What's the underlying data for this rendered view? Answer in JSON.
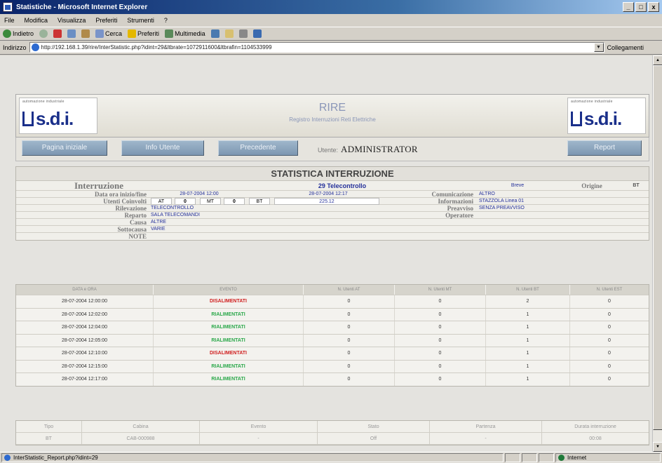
{
  "window": {
    "title": "Statistiche - Microsoft Internet Explorer",
    "min": "_",
    "max": "□",
    "close": "x"
  },
  "menu": [
    "File",
    "Modifica",
    "Visualizza",
    "Preferiti",
    "Strumenti",
    "?"
  ],
  "toolbar": {
    "back": "Indietro",
    "search": "Cerca",
    "favorites": "Preferiti",
    "media": "Multimedia"
  },
  "address": {
    "label": "Indirizzo",
    "url": "http://192.168.1.39/rire/InterStatistic.php?idint=29&ltbrate=1072911600&ltbrafin=1104533999",
    "go": "Collegamenti"
  },
  "header": {
    "logo_small": "automazione industriale",
    "logo_text": "s.d.i.",
    "title": "RIRE",
    "subtitle": "Registro Interruzioni Reti Elettriche"
  },
  "nav": {
    "home": "Pagina iniziale",
    "info": "Info Utente",
    "prev": "Precedente",
    "user_label": "Utente:",
    "user": "ADMINISTRATOR",
    "report": "Report"
  },
  "stat": {
    "title": "STATISTICA INTERRUZIONE",
    "interruzione_label": "Interruzione",
    "interruzione_value": "29 Telecontrollo",
    "breve": "Breve",
    "origine_label": "Origine",
    "origine_value": "BT",
    "data_label": "Data ora inizio/fine",
    "data_inizio": "28-07-2004 12:00",
    "data_fine": "28-07-2004 12:17",
    "comunicazione_label": "Comunicazione",
    "comunicazione_value": "ALTRO",
    "utenti_label": "Utenti Coinvolti",
    "u_at": "AT",
    "u_at_v": "0",
    "u_mt": "MT",
    "u_mt_v": "0",
    "u_bt": "BT",
    "u_bt_v": "225.12",
    "informazioni_label": "Informazioni",
    "informazioni_value": "STAZZOLA Linea 01",
    "rilevazione_label": "Rilevazione",
    "rilevazione_value": "TELECONTROLLO",
    "preavviso_label": "Preavviso",
    "preavviso_value": "SENZA PREAVVISO",
    "reparto_label": "Reparto",
    "reparto_value": "SALA TELECOMANDI",
    "operatore_label": "Operatore",
    "causa_label": "Causa",
    "causa_value": "ALTRE",
    "sottocausa_label": "Sottocausa",
    "sottocausa_value": "VARIE",
    "note_label": "NOTE"
  },
  "events": {
    "headers": [
      "DATA e ORA",
      "EVENTO",
      "N. Utenti AT",
      "N. Utenti MT",
      "N. Utenti BT",
      "N. Utenti EST"
    ],
    "rows": [
      {
        "data": "28-07-2004 12:00:00",
        "evento": "DISALIMENTATI",
        "kind": "dis",
        "at": "0",
        "mt": "0",
        "bt": "2",
        "est": "0"
      },
      {
        "data": "28-07-2004 12:02:00",
        "evento": "RIALIMENTATI",
        "kind": "ria",
        "at": "0",
        "mt": "0",
        "bt": "1",
        "est": "0"
      },
      {
        "data": "28-07-2004 12:04:00",
        "evento": "RIALIMENTATI",
        "kind": "ria",
        "at": "0",
        "mt": "0",
        "bt": "1",
        "est": "0"
      },
      {
        "data": "28-07-2004 12:05:00",
        "evento": "RIALIMENTATI",
        "kind": "ria",
        "at": "0",
        "mt": "0",
        "bt": "1",
        "est": "0"
      },
      {
        "data": "28-07-2004 12:10:00",
        "evento": "DISALIMENTATI",
        "kind": "dis",
        "at": "0",
        "mt": "0",
        "bt": "1",
        "est": "0"
      },
      {
        "data": "28-07-2004 12:15:00",
        "evento": "RIALIMENTATI",
        "kind": "ria",
        "at": "0",
        "mt": "0",
        "bt": "1",
        "est": "0"
      },
      {
        "data": "28-07-2004 12:17:00",
        "evento": "RIALIMENTATI",
        "kind": "ria",
        "at": "0",
        "mt": "0",
        "bt": "1",
        "est": "0"
      }
    ]
  },
  "bottom": {
    "headers": [
      "Tipo",
      "Cabina",
      "Evento",
      "Stato",
      "Partenza",
      "Durata interruzione"
    ],
    "row": [
      "BT",
      "CAB-000988",
      "-",
      "Off",
      "-",
      "00:08"
    ]
  },
  "status": {
    "text": "InterStatistic_Report.php?idint=29",
    "zone": "Internet"
  },
  "colors": {
    "dis": "#d02020",
    "ria": "#2aa84a",
    "link": "#24309a"
  }
}
